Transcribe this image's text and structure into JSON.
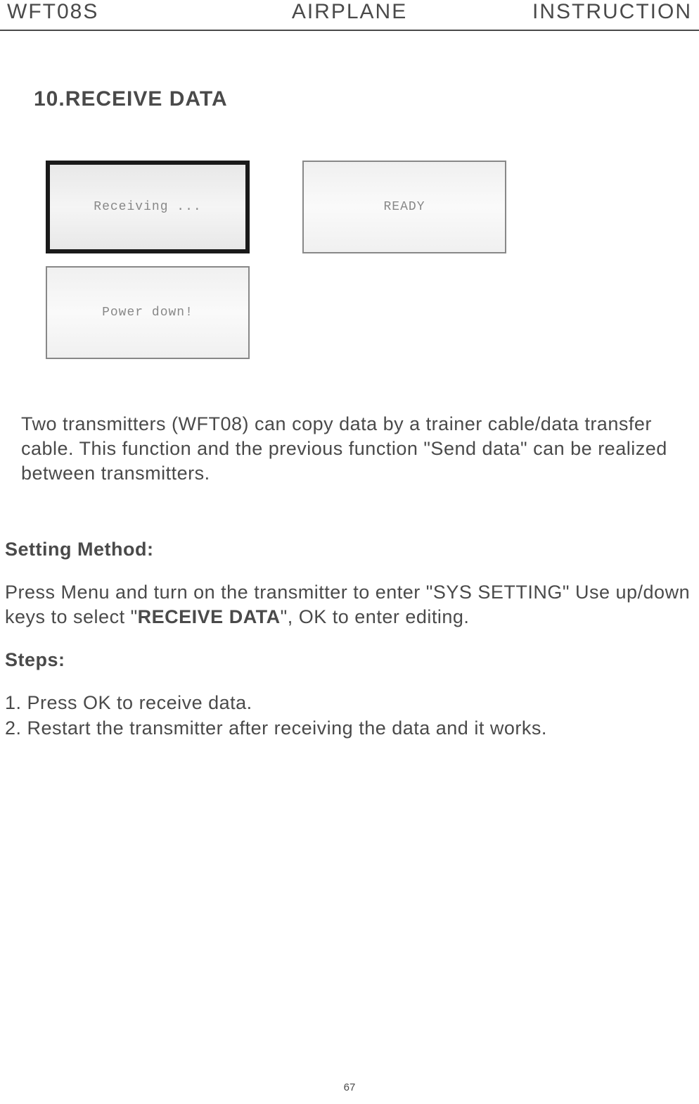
{
  "header": {
    "left": "WFT08S",
    "center": "AIRPLANE",
    "right": "INSTRUCTION"
  },
  "section_title": "10.RECEIVE DATA",
  "screens": {
    "receiving": "Receiving ...",
    "ready": "READY",
    "power_down": "Power down!"
  },
  "description": "Two transmitters (WFT08) can copy data by a trainer cable/data transfer cable. This function and the previous function \"Send data\" can be realized between transmitters.",
  "setting_method": {
    "title": "Setting Method:",
    "line1_pre": "Press Menu and turn on the transmitter to enter \"SYS SETTING\" Use up/down keys to select \"",
    "line1_bold": "RECEIVE DATA",
    "line1_post": "\", OK to enter editing."
  },
  "steps": {
    "title": "Steps:",
    "step1": "1. Press OK to receive data.",
    "step2": "2. Restart the transmitter after receiving the data and it works."
  },
  "page_number": "67"
}
